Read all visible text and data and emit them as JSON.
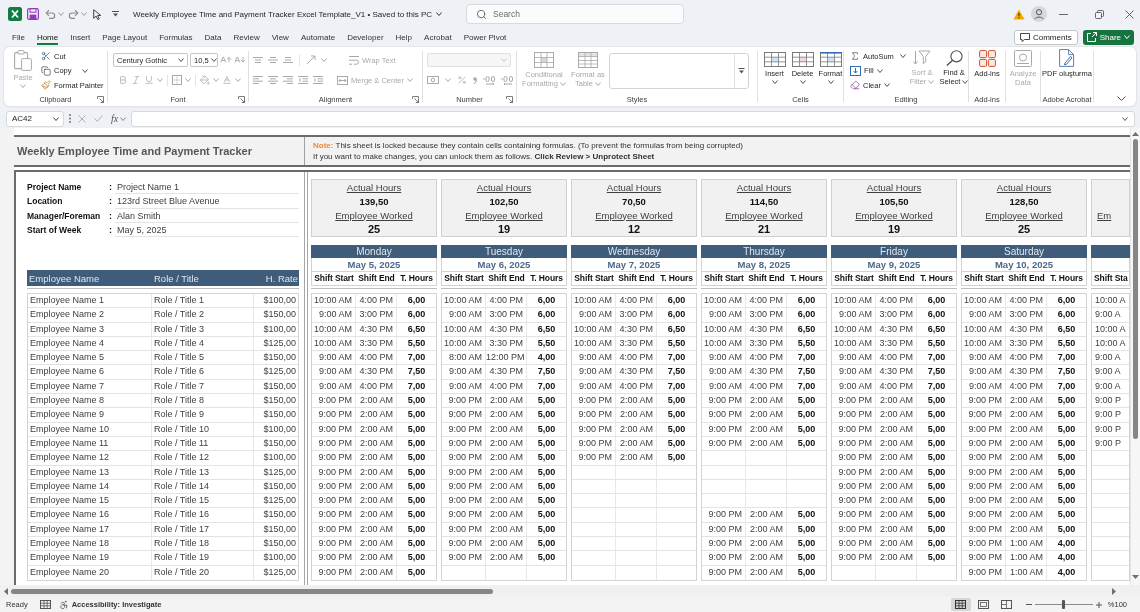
{
  "title_bar": {
    "document_title": "Weekly Employee Time and Payment Tracker Excel Template_V1 • Saved to this PC",
    "search": {
      "placeholder": "Search"
    }
  },
  "menu": {
    "tabs": [
      {
        "label": "File",
        "selected": false
      },
      {
        "label": "Home",
        "selected": true
      },
      {
        "label": "Insert",
        "selected": false
      },
      {
        "label": "Page Layout",
        "selected": false
      },
      {
        "label": "Formulas",
        "selected": false
      },
      {
        "label": "Data",
        "selected": false
      },
      {
        "label": "Review",
        "selected": false
      },
      {
        "label": "View",
        "selected": false
      },
      {
        "label": "Automate",
        "selected": false
      },
      {
        "label": "Developer",
        "selected": false
      },
      {
        "label": "Help",
        "selected": false
      },
      {
        "label": "Acrobat",
        "selected": false
      },
      {
        "label": "Power Pivot",
        "selected": false
      }
    ],
    "comments_button": "Comments",
    "share_button": "Share"
  },
  "ribbon": {
    "clipboard": {
      "title": "Clipboard",
      "paste": {
        "label": "Paste",
        "disabled": true
      },
      "cut": {
        "label": "Cut",
        "disabled": false
      },
      "copy": {
        "label": "Copy",
        "disabled": false
      },
      "format_painter": {
        "label": "Format Painter",
        "disabled": false
      }
    },
    "font": {
      "title": "Font",
      "font_name": "Century Gothic",
      "font_size": "10,5"
    },
    "alignment": {
      "title": "Alignment",
      "wrap_text": {
        "label": "Wrap Text",
        "disabled": true
      },
      "merge_center": {
        "label": "Merge & Center",
        "disabled": true
      }
    },
    "number": {
      "title": "Number"
    },
    "styles": {
      "title": "Styles",
      "conditional_formatting": {
        "label": "Conditional Formatting",
        "disabled": true
      },
      "format_as_table": {
        "label": "Format as Table",
        "disabled": true
      }
    },
    "cells": {
      "title": "Cells",
      "insert": {
        "label": "Insert",
        "disabled": false
      },
      "delete": {
        "label": "Delete",
        "disabled": false
      },
      "format": {
        "label": "Format",
        "disabled": false
      }
    },
    "editing": {
      "title": "Editing",
      "autosum": {
        "label": "AutoSum",
        "disabled": false
      },
      "fill": {
        "label": "Fill",
        "disabled": false
      },
      "clear": {
        "label": "Clear",
        "disabled": false
      },
      "sort_filter": {
        "label": "Sort & Filter",
        "disabled": true
      },
      "find_select": {
        "label": "Find & Select",
        "disabled": false
      }
    },
    "add_ins": {
      "title": "Add-ins",
      "add_ins": {
        "label": "Add-ins",
        "disabled": false
      }
    },
    "analysis": {
      "analyze_data": {
        "label": "Analyze Data",
        "disabled": true
      }
    },
    "adobe_acrobat": {
      "title": "Adobe Acrobat",
      "create_pdf": {
        "label": "PDF oluşturma",
        "disabled": false
      }
    }
  },
  "formula_bar": {
    "name_box": "AC42",
    "function_button": "fx"
  },
  "sheet": {
    "title": "Weekly Employee Time and Payment Tracker",
    "note": {
      "label": "Note:",
      "lines": [
        "This sheet is locked because they contain cells containing formulas. (To prevent the formulas from being corrupted)",
        "If you want to make changes, you can unlock them as follows. **Click Review > Unprotect Sheet**"
      ]
    },
    "project_info": [
      {
        "label": "Project Name",
        "separator": ":",
        "value": "Project Name 1"
      },
      {
        "label": "Location",
        "separator": ":",
        "value": "123rd Street Blue Avenue"
      },
      {
        "label": "Manager/Foreman",
        "separator": ":",
        "value": "Alan Smith"
      },
      {
        "label": "Start of Week",
        "separator": ":",
        "value": "May 5, 2025"
      }
    ],
    "employee_columns": [
      "Employee Name",
      "Role / Title",
      "H. Rate"
    ],
    "employees": [
      {
        "name": "Employee Name 1",
        "role": "Role / Title 1",
        "rate": "$100,00"
      },
      {
        "name": "Employee Name 2",
        "role": "Role / Title 2",
        "rate": "$150,00"
      },
      {
        "name": "Employee Name 3",
        "role": "Role / Title 3",
        "rate": "$100,00"
      },
      {
        "name": "Employee Name 4",
        "role": "Role / Title 4",
        "rate": "$125,00"
      },
      {
        "name": "Employee Name 5",
        "role": "Role / Title 5",
        "rate": "$150,00"
      },
      {
        "name": "Employee Name 6",
        "role": "Role / Title 6",
        "rate": "$125,00"
      },
      {
        "name": "Employee Name 7",
        "role": "Role / Title 7",
        "rate": "$150,00"
      },
      {
        "name": "Employee Name 8",
        "role": "Role / Title 8",
        "rate": "$150,00"
      },
      {
        "name": "Employee Name 9",
        "role": "Role / Title 9",
        "rate": "$150,00"
      },
      {
        "name": "Employee Name 10",
        "role": "Role / Title 10",
        "rate": "$100,00"
      },
      {
        "name": "Employee Name 11",
        "role": "Role / Title 11",
        "rate": "$150,00"
      },
      {
        "name": "Employee Name 12",
        "role": "Role / Title 12",
        "rate": "$100,00"
      },
      {
        "name": "Employee Name 13",
        "role": "Role / Title 13",
        "rate": "$125,00"
      },
      {
        "name": "Employee Name 14",
        "role": "Role / Title 14",
        "rate": "$150,00"
      },
      {
        "name": "Employee Name 15",
        "role": "Role / Title 15",
        "rate": "$125,00"
      },
      {
        "name": "Employee Name 16",
        "role": "Role / Title 16",
        "rate": "$150,00"
      },
      {
        "name": "Employee Name 17",
        "role": "Role / Title 17",
        "rate": "$150,00"
      },
      {
        "name": "Employee Name 18",
        "role": "Role / Title 18",
        "rate": "$150,00"
      },
      {
        "name": "Employee Name 19",
        "role": "Role / Title 19",
        "rate": "$100,00"
      },
      {
        "name": "Employee Name 20",
        "role": "Role / Title 20",
        "rate": "$125,00"
      }
    ],
    "days": [
      {
        "summary": {
          "actual_hours_label": "Actual Hours",
          "actual_hours": "139,50",
          "employee_worked_label": "Employee Worked",
          "employee_worked": "25"
        },
        "day": "Monday",
        "date": "May 5, 2025",
        "columns": [
          "Shift Start",
          "Shift End",
          "T. Hours"
        ],
        "shifts": [
          {
            "kind": "shift",
            "start": "10:00 AM",
            "end": "4:00 PM",
            "hours": "6,00"
          },
          {
            "kind": "shift",
            "start": "9:00 AM",
            "end": "3:00 PM",
            "hours": "6,00"
          },
          {
            "kind": "shift",
            "start": "10:00 AM",
            "end": "4:30 PM",
            "hours": "6,50"
          },
          {
            "kind": "shift",
            "start": "10:00 AM",
            "end": "3:30 PM",
            "hours": "5,50"
          },
          {
            "kind": "shift",
            "start": "9:00 AM",
            "end": "4:00 PM",
            "hours": "7,00"
          },
          {
            "kind": "shift",
            "start": "9:00 AM",
            "end": "4:30 PM",
            "hours": "7,50"
          },
          {
            "kind": "shift",
            "start": "9:00 AM",
            "end": "4:00 PM",
            "hours": "7,00"
          },
          {
            "kind": "shift",
            "start": "9:00 PM",
            "end": "2:00 AM",
            "hours": "5,00"
          },
          {
            "kind": "shift",
            "start": "9:00 PM",
            "end": "2:00 AM",
            "hours": "5,00"
          },
          {
            "kind": "shift",
            "start": "9:00 PM",
            "end": "2:00 AM",
            "hours": "5,00"
          },
          {
            "kind": "shift",
            "start": "9:00 PM",
            "end": "2:00 AM",
            "hours": "5,00"
          },
          {
            "kind": "shift",
            "start": "9:00 PM",
            "end": "2:00 AM",
            "hours": "5,00"
          },
          {
            "kind": "shift",
            "start": "9:00 PM",
            "end": "2:00 AM",
            "hours": "5,00"
          },
          {
            "kind": "shift",
            "start": "9:00 PM",
            "end": "2:00 AM",
            "hours": "5,00"
          },
          {
            "kind": "shift",
            "start": "9:00 PM",
            "end": "2:00 AM",
            "hours": "5,00"
          },
          {
            "kind": "shift",
            "start": "9:00 PM",
            "end": "2:00 AM",
            "hours": "5,00"
          },
          {
            "kind": "shift",
            "start": "9:00 PM",
            "end": "2:00 AM",
            "hours": "5,00"
          },
          {
            "kind": "shift",
            "start": "9:00 PM",
            "end": "2:00 AM",
            "hours": "5,00"
          },
          {
            "kind": "shift",
            "start": "9:00 PM",
            "end": "2:00 AM",
            "hours": "5,00"
          },
          {
            "kind": "shift",
            "start": "9:00 PM",
            "end": "2:00 AM",
            "hours": "5,00"
          }
        ]
      },
      {
        "summary": {
          "actual_hours_label": "Actual Hours",
          "actual_hours": "102,50",
          "employee_worked_label": "Employee Worked",
          "employee_worked": "19"
        },
        "day": "Tuesday",
        "date": "May 6, 2025",
        "columns": [
          "Shift Start",
          "Shift End",
          "T. Hours"
        ],
        "shifts": [
          {
            "kind": "shift",
            "start": "10:00 AM",
            "end": "4:00 PM",
            "hours": "6,00"
          },
          {
            "kind": "shift",
            "start": "9:00 AM",
            "end": "3:00 PM",
            "hours": "6,00"
          },
          {
            "kind": "shift",
            "start": "10:00 AM",
            "end": "4:30 PM",
            "hours": "6,50"
          },
          {
            "kind": "shift",
            "start": "10:00 AM",
            "end": "3:30 PM",
            "hours": "5,50"
          },
          {
            "kind": "shift",
            "start": "8:00 AM",
            "end": "12:00 PM",
            "hours": "4,00"
          },
          {
            "kind": "shift",
            "start": "9:00 AM",
            "end": "4:30 PM",
            "hours": "7,50"
          },
          {
            "kind": "shift",
            "start": "9:00 AM",
            "end": "4:00 PM",
            "hours": "7,00"
          },
          {
            "kind": "shift",
            "start": "9:00 PM",
            "end": "2:00 AM",
            "hours": "5,00"
          },
          {
            "kind": "shift",
            "start": "9:00 PM",
            "end": "2:00 AM",
            "hours": "5,00"
          },
          {
            "kind": "shift",
            "start": "9:00 PM",
            "end": "2:00 AM",
            "hours": "5,00"
          },
          {
            "kind": "shift",
            "start": "9:00 PM",
            "end": "2:00 AM",
            "hours": "5,00"
          },
          {
            "kind": "shift",
            "start": "9:00 PM",
            "end": "2:00 AM",
            "hours": "5,00"
          },
          {
            "kind": "shift",
            "start": "9:00 PM",
            "end": "2:00 AM",
            "hours": "5,00"
          },
          {
            "kind": "shift",
            "start": "9:00 PM",
            "end": "2:00 AM",
            "hours": "5,00"
          },
          {
            "kind": "shift",
            "start": "9:00 PM",
            "end": "2:00 AM",
            "hours": "5,00"
          },
          {
            "kind": "shift",
            "start": "9:00 PM",
            "end": "2:00 AM",
            "hours": "5,00"
          },
          {
            "kind": "shift",
            "start": "9:00 PM",
            "end": "2:00 AM",
            "hours": "5,00"
          },
          {
            "kind": "shift",
            "start": "9:00 PM",
            "end": "2:00 AM",
            "hours": "5,00"
          },
          {
            "kind": "shift",
            "start": "9:00 PM",
            "end": "2:00 AM",
            "hours": "5,00"
          },
          {
            "kind": "empty"
          }
        ]
      },
      {
        "summary": {
          "actual_hours_label": "Actual Hours",
          "actual_hours": "70,50",
          "employee_worked_label": "Employee Worked",
          "employee_worked": "12"
        },
        "day": "Wednesday",
        "date": "May 7, 2025",
        "columns": [
          "Shift Start",
          "Shift End",
          "T. Hours"
        ],
        "shifts": [
          {
            "kind": "shift",
            "start": "10:00 AM",
            "end": "4:00 PM",
            "hours": "6,00"
          },
          {
            "kind": "shift",
            "start": "9:00 AM",
            "end": "3:00 PM",
            "hours": "6,00"
          },
          {
            "kind": "shift",
            "start": "10:00 AM",
            "end": "4:30 PM",
            "hours": "6,50"
          },
          {
            "kind": "shift",
            "start": "10:00 AM",
            "end": "3:30 PM",
            "hours": "5,50"
          },
          {
            "kind": "shift",
            "start": "9:00 AM",
            "end": "4:00 PM",
            "hours": "7,00"
          },
          {
            "kind": "shift",
            "start": "9:00 AM",
            "end": "4:30 PM",
            "hours": "7,50"
          },
          {
            "kind": "shift",
            "start": "9:00 AM",
            "end": "4:00 PM",
            "hours": "7,00"
          },
          {
            "kind": "shift",
            "start": "9:00 PM",
            "end": "2:00 AM",
            "hours": "5,00"
          },
          {
            "kind": "shift",
            "start": "9:00 PM",
            "end": "2:00 AM",
            "hours": "5,00"
          },
          {
            "kind": "shift",
            "start": "9:00 PM",
            "end": "2:00 AM",
            "hours": "5,00"
          },
          {
            "kind": "shift",
            "start": "9:00 PM",
            "end": "2:00 AM",
            "hours": "5,00"
          },
          {
            "kind": "shift",
            "start": "9:00 PM",
            "end": "2:00 AM",
            "hours": "5,00"
          },
          {
            "kind": "empty"
          },
          {
            "kind": "empty"
          },
          {
            "kind": "empty"
          },
          {
            "kind": "empty"
          },
          {
            "kind": "empty"
          },
          {
            "kind": "empty"
          },
          {
            "kind": "empty"
          },
          {
            "kind": "empty"
          }
        ]
      },
      {
        "summary": {
          "actual_hours_label": "Actual Hours",
          "actual_hours": "114,50",
          "employee_worked_label": "Employee Worked",
          "employee_worked": "21"
        },
        "day": "Thursday",
        "date": "May 8, 2025",
        "columns": [
          "Shift Start",
          "Shift End",
          "T. Hours"
        ],
        "shifts": [
          {
            "kind": "shift",
            "start": "10:00 AM",
            "end": "4:00 PM",
            "hours": "6,00"
          },
          {
            "kind": "shift",
            "start": "9:00 AM",
            "end": "3:00 PM",
            "hours": "6,00"
          },
          {
            "kind": "shift",
            "start": "10:00 AM",
            "end": "4:30 PM",
            "hours": "6,50"
          },
          {
            "kind": "shift",
            "start": "10:00 AM",
            "end": "3:30 PM",
            "hours": "5,50"
          },
          {
            "kind": "shift",
            "start": "9:00 AM",
            "end": "4:00 PM",
            "hours": "7,00"
          },
          {
            "kind": "shift",
            "start": "9:00 AM",
            "end": "4:30 PM",
            "hours": "7,50"
          },
          {
            "kind": "shift",
            "start": "9:00 AM",
            "end": "4:00 PM",
            "hours": "7,00"
          },
          {
            "kind": "shift",
            "start": "9:00 PM",
            "end": "2:00 AM",
            "hours": "5,00"
          },
          {
            "kind": "shift",
            "start": "9:00 PM",
            "end": "2:00 AM",
            "hours": "5,00"
          },
          {
            "kind": "shift",
            "start": "9:00 PM",
            "end": "2:00 AM",
            "hours": "5,00"
          },
          {
            "kind": "shift",
            "start": "9:00 PM",
            "end": "2:00 AM",
            "hours": "5,00"
          },
          {
            "kind": "empty"
          },
          {
            "kind": "empty"
          },
          {
            "kind": "empty"
          },
          {
            "kind": "empty"
          },
          {
            "kind": "shift",
            "start": "9:00 PM",
            "end": "2:00 AM",
            "hours": "5,00"
          },
          {
            "kind": "shift",
            "start": "9:00 PM",
            "end": "2:00 AM",
            "hours": "5,00"
          },
          {
            "kind": "shift",
            "start": "9:00 PM",
            "end": "2:00 AM",
            "hours": "5,00"
          },
          {
            "kind": "shift",
            "start": "9:00 PM",
            "end": "2:00 AM",
            "hours": "5,00"
          },
          {
            "kind": "shift",
            "start": "9:00 PM",
            "end": "2:00 AM",
            "hours": "5,00"
          }
        ]
      },
      {
        "summary": {
          "actual_hours_label": "Actual Hours",
          "actual_hours": "105,50",
          "employee_worked_label": "Employee Worked",
          "employee_worked": "19"
        },
        "day": "Friday",
        "date": "May 9, 2025",
        "columns": [
          "Shift Start",
          "Shift End",
          "T. Hours"
        ],
        "shifts": [
          {
            "kind": "shift",
            "start": "10:00 AM",
            "end": "4:00 PM",
            "hours": "6,00"
          },
          {
            "kind": "shift",
            "start": "9:00 AM",
            "end": "3:00 PM",
            "hours": "6,00"
          },
          {
            "kind": "shift",
            "start": "10:00 AM",
            "end": "4:30 PM",
            "hours": "6,50"
          },
          {
            "kind": "shift",
            "start": "10:00 AM",
            "end": "3:30 PM",
            "hours": "5,50"
          },
          {
            "kind": "shift",
            "start": "9:00 AM",
            "end": "4:00 PM",
            "hours": "7,00"
          },
          {
            "kind": "shift",
            "start": "9:00 AM",
            "end": "4:30 PM",
            "hours": "7,50"
          },
          {
            "kind": "shift",
            "start": "9:00 AM",
            "end": "4:00 PM",
            "hours": "7,00"
          },
          {
            "kind": "shift",
            "start": "9:00 PM",
            "end": "2:00 AM",
            "hours": "5,00"
          },
          {
            "kind": "shift",
            "start": "9:00 PM",
            "end": "2:00 AM",
            "hours": "5,00"
          },
          {
            "kind": "shift",
            "start": "9:00 PM",
            "end": "2:00 AM",
            "hours": "5,00"
          },
          {
            "kind": "shift",
            "start": "9:00 PM",
            "end": "2:00 AM",
            "hours": "5,00"
          },
          {
            "kind": "shift",
            "start": "9:00 PM",
            "end": "2:00 AM",
            "hours": "5,00"
          },
          {
            "kind": "shift",
            "start": "9:00 PM",
            "end": "2:00 AM",
            "hours": "5,00"
          },
          {
            "kind": "shift",
            "start": "9:00 PM",
            "end": "2:00 AM",
            "hours": "5,00"
          },
          {
            "kind": "shift",
            "start": "9:00 PM",
            "end": "2:00 AM",
            "hours": "5,00"
          },
          {
            "kind": "shift",
            "start": "9:00 PM",
            "end": "2:00 AM",
            "hours": "5,00"
          },
          {
            "kind": "shift",
            "start": "9:00 PM",
            "end": "2:00 AM",
            "hours": "5,00"
          },
          {
            "kind": "shift",
            "start": "9:00 PM",
            "end": "2:00 AM",
            "hours": "5,00"
          },
          {
            "kind": "shift",
            "start": "9:00 PM",
            "end": "2:00 AM",
            "hours": "5,00"
          },
          {
            "kind": "empty"
          }
        ]
      },
      {
        "summary": {
          "actual_hours_label": "Actual Hours",
          "actual_hours": "128,50",
          "employee_worked_label": "Employee Worked",
          "employee_worked": "25"
        },
        "day": "Saturday",
        "date": "May 10, 2025",
        "columns": [
          "Shift Start",
          "Shift End",
          "T. Hours"
        ],
        "shifts": [
          {
            "kind": "shift",
            "start": "10:00 AM",
            "end": "4:00 PM",
            "hours": "6,00"
          },
          {
            "kind": "shift",
            "start": "9:00 AM",
            "end": "3:00 PM",
            "hours": "6,00"
          },
          {
            "kind": "shift",
            "start": "10:00 AM",
            "end": "4:30 PM",
            "hours": "6,50"
          },
          {
            "kind": "shift",
            "start": "10:00 AM",
            "end": "3:30 PM",
            "hours": "5,50"
          },
          {
            "kind": "shift",
            "start": "9:00 AM",
            "end": "4:00 PM",
            "hours": "7,00"
          },
          {
            "kind": "shift",
            "start": "9:00 AM",
            "end": "4:30 PM",
            "hours": "7,50"
          },
          {
            "kind": "shift",
            "start": "9:00 AM",
            "end": "4:00 PM",
            "hours": "7,00"
          },
          {
            "kind": "shift",
            "start": "9:00 PM",
            "end": "2:00 AM",
            "hours": "5,00"
          },
          {
            "kind": "shift",
            "start": "9:00 PM",
            "end": "2:00 AM",
            "hours": "5,00"
          },
          {
            "kind": "shift",
            "start": "9:00 PM",
            "end": "2:00 AM",
            "hours": "5,00"
          },
          {
            "kind": "shift",
            "start": "9:00 PM",
            "end": "2:00 AM",
            "hours": "5,00"
          },
          {
            "kind": "shift",
            "start": "9:00 PM",
            "end": "2:00 AM",
            "hours": "5,00"
          },
          {
            "kind": "shift",
            "start": "9:00 PM",
            "end": "2:00 AM",
            "hours": "5,00"
          },
          {
            "kind": "shift",
            "start": "9:00 PM",
            "end": "2:00 AM",
            "hours": "5,00"
          },
          {
            "kind": "shift",
            "start": "9:00 PM",
            "end": "2:00 AM",
            "hours": "5,00"
          },
          {
            "kind": "shift",
            "start": "9:00 PM",
            "end": "2:00 AM",
            "hours": "5,00"
          },
          {
            "kind": "shift",
            "start": "9:00 PM",
            "end": "2:00 AM",
            "hours": "5,00"
          },
          {
            "kind": "shift",
            "start": "9:00 PM",
            "end": "1:00 AM",
            "hours": "4,00"
          },
          {
            "kind": "shift",
            "start": "9:00 PM",
            "end": "1:00 AM",
            "hours": "4,00"
          },
          {
            "kind": "shift",
            "start": "9:00 PM",
            "end": "1:00 AM",
            "hours": "4,00"
          }
        ]
      },
      {
        "summary": {
          "employee_worked_label": "Em"
        },
        "columns": [
          "Shift Sta"
        ],
        "shifts": [
          {
            "kind": "shift",
            "start": "10:00 A"
          },
          {
            "kind": "shift",
            "start": "9:00 A"
          },
          {
            "kind": "shift",
            "start": "10:00 A"
          },
          {
            "kind": "shift",
            "start": "10:00 A"
          },
          {
            "kind": "shift",
            "start": "9:00 A"
          },
          {
            "kind": "shift",
            "start": "9:00 A"
          },
          {
            "kind": "shift",
            "start": "9:00 A"
          },
          {
            "kind": "shift",
            "start": "9:00 P"
          },
          {
            "kind": "shift",
            "start": "9:00 P"
          },
          {
            "kind": "shift",
            "start": "9:00 P"
          },
          {
            "kind": "shift",
            "start": "9:00 P"
          },
          {
            "kind": "empty"
          },
          {
            "kind": "empty"
          },
          {
            "kind": "empty"
          },
          {
            "kind": "empty"
          },
          {
            "kind": "empty"
          },
          {
            "kind": "empty"
          },
          {
            "kind": "empty"
          },
          {
            "kind": "empty"
          },
          {
            "kind": "empty"
          }
        ]
      }
    ]
  },
  "status_bar": {
    "status": "Ready",
    "accessibility": "Accessibility: Investigate",
    "views": [
      {
        "selected": true
      },
      {
        "selected": false
      },
      {
        "selected": false
      }
    ],
    "zoom": {
      "label": "%100",
      "level": 0.5
    }
  }
}
